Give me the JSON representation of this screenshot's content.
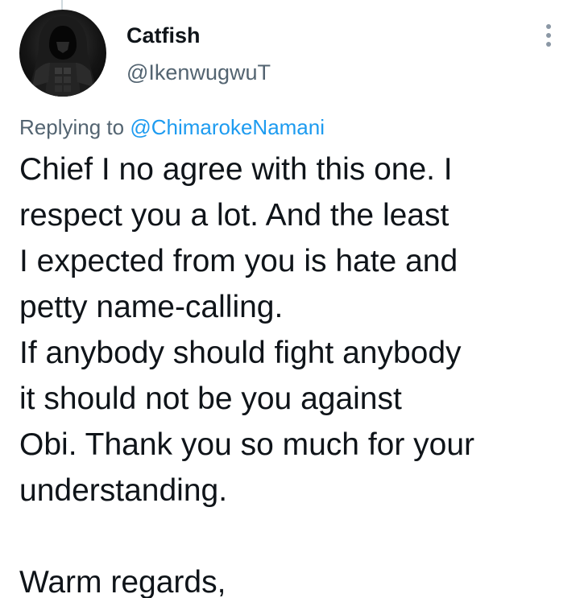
{
  "tweet": {
    "author": {
      "display_name": "Catfish",
      "handle": "@IkenwugwuT",
      "avatar_icon": "hooded-figure-avatar"
    },
    "more_icon": "more-options-icon",
    "replying_to": {
      "prefix": "Replying to",
      "mention": "@ChimarokeNamani"
    },
    "body_lines": [
      "Chief I no agree with this one. I",
      "respect you a lot. And the least",
      "I expected from you is hate and",
      "petty name-calling.",
      "If anybody should fight anybody",
      "it should not be you against",
      "Obi. Thank you so much for your",
      "understanding.",
      "",
      "Warm regards,"
    ]
  },
  "colors": {
    "text": "#0f1419",
    "secondary_text": "#536471",
    "link": "#1d9bf0",
    "background": "#ffffff"
  }
}
